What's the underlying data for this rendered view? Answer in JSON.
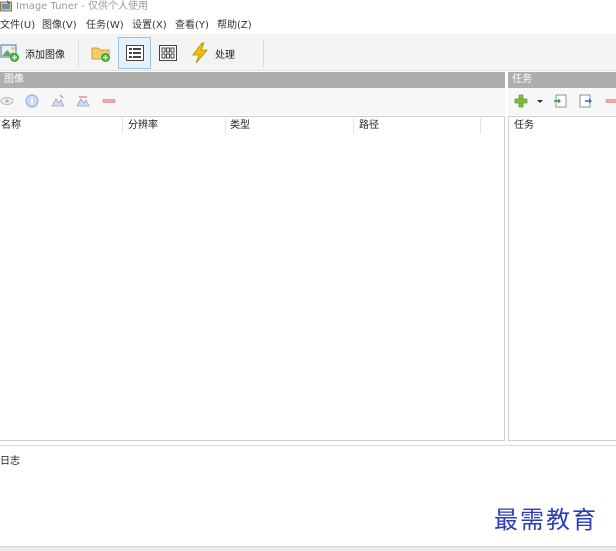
{
  "window": {
    "title": "Image Tuner - 仅供个人使用",
    "icon": "app-icon"
  },
  "menu": [
    {
      "label": "文件(U)"
    },
    {
      "label": "图像(V)"
    },
    {
      "label": "任务(W)"
    },
    {
      "label": "设置(X)"
    },
    {
      "label": "查看(Y)"
    },
    {
      "label": "帮助(Z)"
    }
  ],
  "toolbar": {
    "add_images_label": "添加图像",
    "process_label": "处理",
    "add_folder_icon": "add-folder-icon",
    "details_view_icon": "details-view-icon",
    "thumbnail_view_icon": "thumbnail-view-icon",
    "lightning_icon": "lightning-icon"
  },
  "images_panel": {
    "header": "图像",
    "columns": [
      "名称",
      "分辨率",
      "类型",
      "路径"
    ]
  },
  "tasks_panel": {
    "header": "任务",
    "columns": [
      "任务"
    ]
  },
  "log": {
    "label": "日志"
  },
  "watermark": "最需教育",
  "colors": {
    "panel_header_bg": "#aeaeae",
    "watermark": "#2a3bbd",
    "pressed_bg": "#e5f1fb"
  }
}
